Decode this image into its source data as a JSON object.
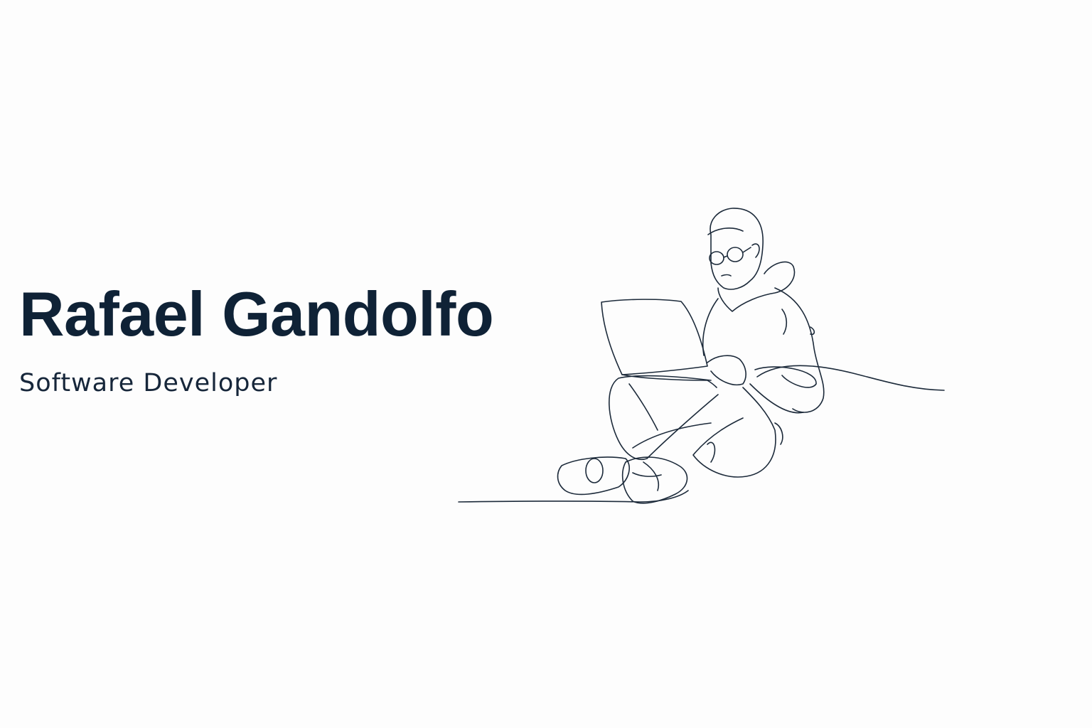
{
  "hero": {
    "name": "Rafael Gandolfo",
    "role": "Software Developer"
  },
  "illustration": {
    "icon": "developer-with-laptop-line-drawing"
  },
  "colors": {
    "background": "#fdfdfd",
    "name_text": "#0f2236",
    "role_text": "#16263a",
    "line_art": "#1c2a3a"
  }
}
